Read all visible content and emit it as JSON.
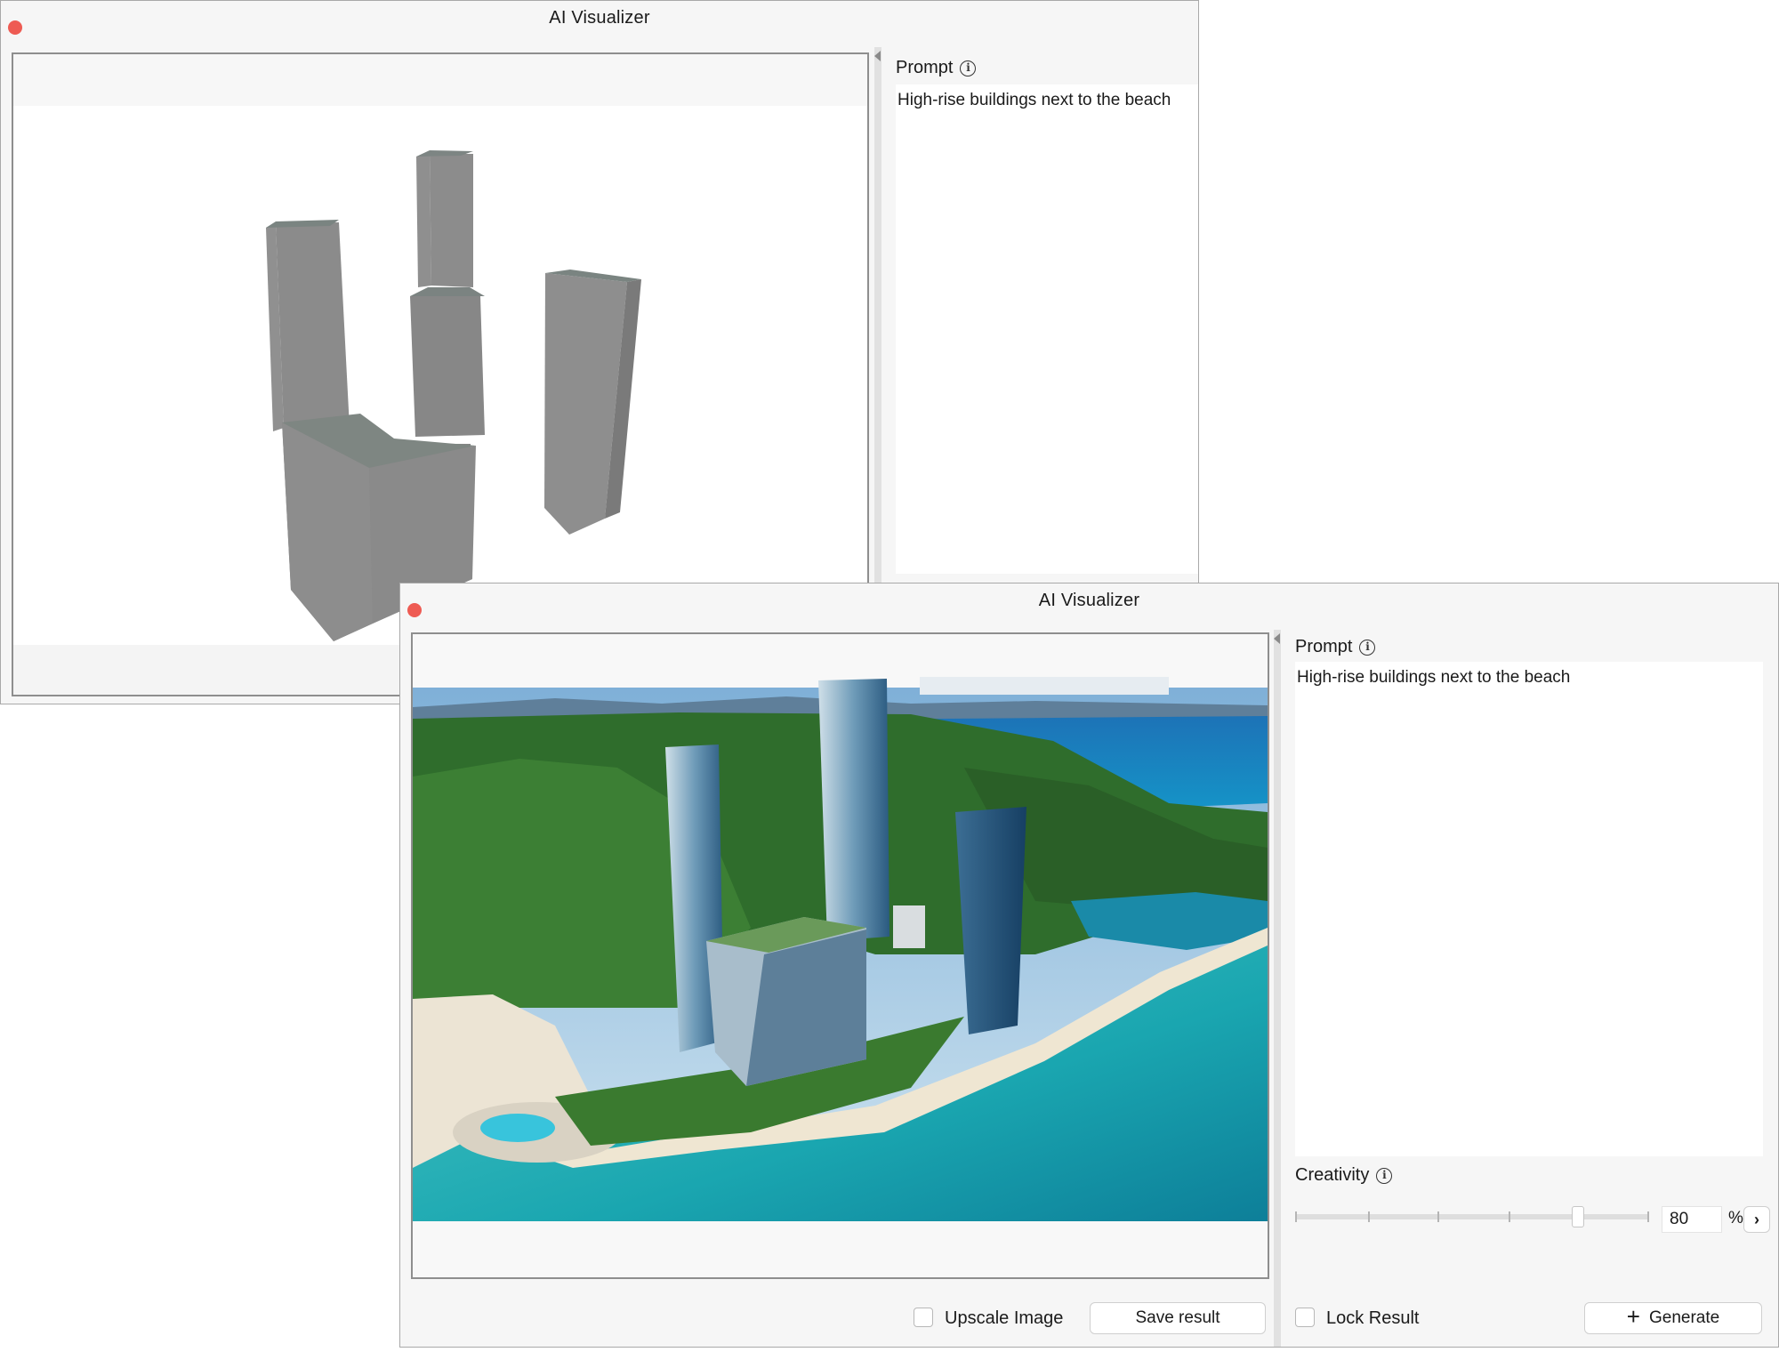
{
  "back_window": {
    "title": "AI Visualizer",
    "prompt_label": "Prompt",
    "prompt_text": "High-rise buildings next to the beach"
  },
  "front_window": {
    "title": "AI Visualizer",
    "prompt_label": "Prompt",
    "prompt_text": "High-rise buildings next to the beach",
    "creativity_label": "Creativity",
    "creativity_value": "80",
    "creativity_unit": "%",
    "creativity_fraction": 0.8,
    "upscale_label": "Upscale Image",
    "save_label": "Save result",
    "lock_label": "Lock Result",
    "generate_label": "Generate"
  },
  "colors": {
    "close_button": "#ee5b53",
    "sea": "#1aa6b0",
    "forest": "#2d6a2a",
    "building_gray": "#8a8a8a"
  }
}
